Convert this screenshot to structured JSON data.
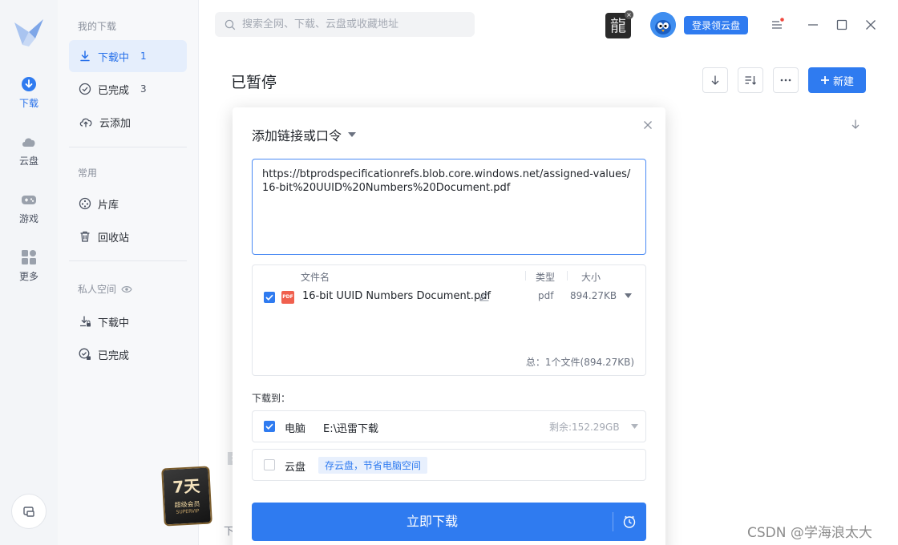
{
  "rail": {
    "items": [
      {
        "label": "下载",
        "icon": "download-circle-icon",
        "active": true
      },
      {
        "label": "云盘",
        "icon": "cloud-icon"
      },
      {
        "label": "游戏",
        "icon": "gamepad-icon"
      },
      {
        "label": "更多",
        "icon": "apps-grid-icon"
      }
    ]
  },
  "sidebar": {
    "my_downloads_title": "我的下载",
    "items": [
      {
        "label": "下载中",
        "count": "1"
      },
      {
        "label": "已完成",
        "count": "3"
      },
      {
        "label": "云添加"
      }
    ],
    "common_title": "常用",
    "common_items": [
      {
        "label": "片库"
      },
      {
        "label": "回收站"
      }
    ],
    "private_title": "私人空间",
    "private_items": [
      {
        "label": "下载中"
      },
      {
        "label": "已完成"
      }
    ],
    "promo": {
      "big": "7天",
      "small": "超级会员",
      "tiny": "SUPERVIP"
    },
    "promo_close": "×"
  },
  "topbar": {
    "search_placeholder": "搜索全网、下载、云盘或收藏地址",
    "game_avatar_char": "龍",
    "login_button": "登录领云盘"
  },
  "main": {
    "title": "已暂停",
    "new_button": "新建",
    "behind_text": "下"
  },
  "dialog": {
    "title": "添加链接或口令",
    "link_value": "https://btprodspecificationrefs.blob.core.windows.net/assigned-values/16-bit%20UUID%20Numbers%20Document.pdf",
    "columns": {
      "name": "文件名",
      "type": "类型",
      "size": "大小"
    },
    "file": {
      "badge": "PDF",
      "name": "16-bit UUID Numbers Document.pdf",
      "type": "pdf",
      "size": "894.27KB",
      "checked": true
    },
    "total": "总：1个文件(894.27KB)",
    "download_to_label": "下载到：",
    "pc": {
      "name": "电脑",
      "path": "E:\\迅雷下载",
      "free": "剩余:152.29GB",
      "checked": true
    },
    "cloud": {
      "name": "云盘",
      "tag": "存云盘，节省电脑空间",
      "checked": false
    },
    "download_button": "立即下载"
  },
  "watermark": "CSDN @学海浪太大",
  "colors": {
    "accent": "#2f7bf0",
    "sidebar_active_bg": "#e5eefc"
  }
}
